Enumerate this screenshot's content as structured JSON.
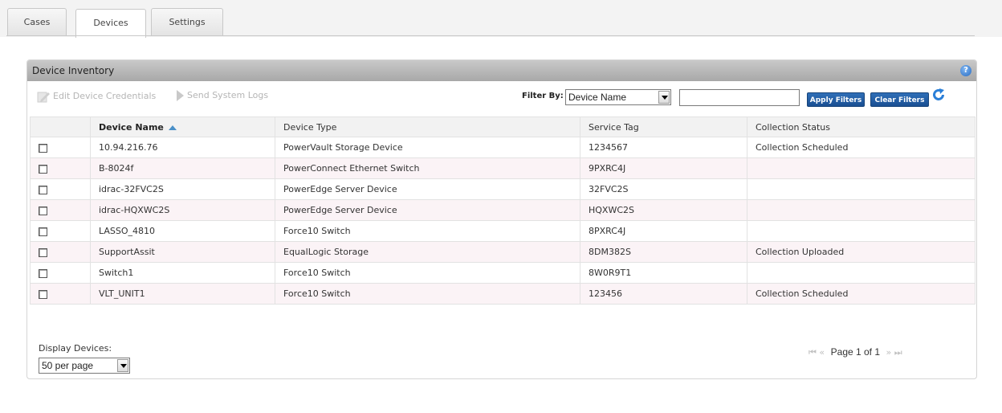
{
  "tabs": [
    {
      "label": "Cases",
      "active": false
    },
    {
      "label": "Devices",
      "active": true
    },
    {
      "label": "Settings",
      "active": false
    }
  ],
  "panel": {
    "title": "Device Inventory",
    "help_icon": "help-icon",
    "help_glyph": "?"
  },
  "toolbar": {
    "edit_credentials_label": "Edit Device Credentials",
    "send_logs_label": "Send System Logs",
    "filter_by_label": "Filter By:",
    "filter_field_value": "Device Name",
    "filter_text_value": "",
    "apply_filters_label": "Apply Filters",
    "clear_filters_label": "Clear Filters",
    "refresh_icon": "refresh-icon"
  },
  "table": {
    "columns": [
      "Device Name",
      "Device Type",
      "Service Tag",
      "Collection Status"
    ],
    "sort_column": "Device Name",
    "sort_direction": "ascending",
    "rows": [
      {
        "name": "10.94.216.76",
        "type": "PowerVault Storage Device",
        "tag": "1234567",
        "status": "Collection Scheduled"
      },
      {
        "name": "B-8024f",
        "type": "PowerConnect Ethernet Switch",
        "tag": "9PXRC4J",
        "status": ""
      },
      {
        "name": "idrac-32FVC2S",
        "type": "PowerEdge Server Device",
        "tag": "32FVC2S",
        "status": ""
      },
      {
        "name": "idrac-HQXWC2S",
        "type": "PowerEdge Server Device",
        "tag": "HQXWC2S",
        "status": ""
      },
      {
        "name": "LASSO_4810",
        "type": "Force10 Switch",
        "tag": "8PXRC4J",
        "status": ""
      },
      {
        "name": "SupportAssit",
        "type": "EqualLogic Storage",
        "tag": "8DM382S",
        "status": "Collection Uploaded"
      },
      {
        "name": "Switch1",
        "type": "Force10 Switch",
        "tag": "8W0R9T1",
        "status": ""
      },
      {
        "name": "VLT_UNIT1",
        "type": "Force10 Switch",
        "tag": "123456",
        "status": "Collection Scheduled"
      }
    ]
  },
  "footer": {
    "display_label": "Display Devices:",
    "per_page_value": "50 per page",
    "page_text": "Page 1 of 1",
    "first_glyph": "⏮",
    "prev_glyph": "«",
    "next_glyph": "»",
    "last_glyph": "⏭"
  },
  "colors": {
    "header_gradient_top": "#c9c9c9",
    "button_blue": "#1a4f92",
    "row_alt": "#fbf3f6",
    "refresh_blue": "#2a7fd8"
  }
}
